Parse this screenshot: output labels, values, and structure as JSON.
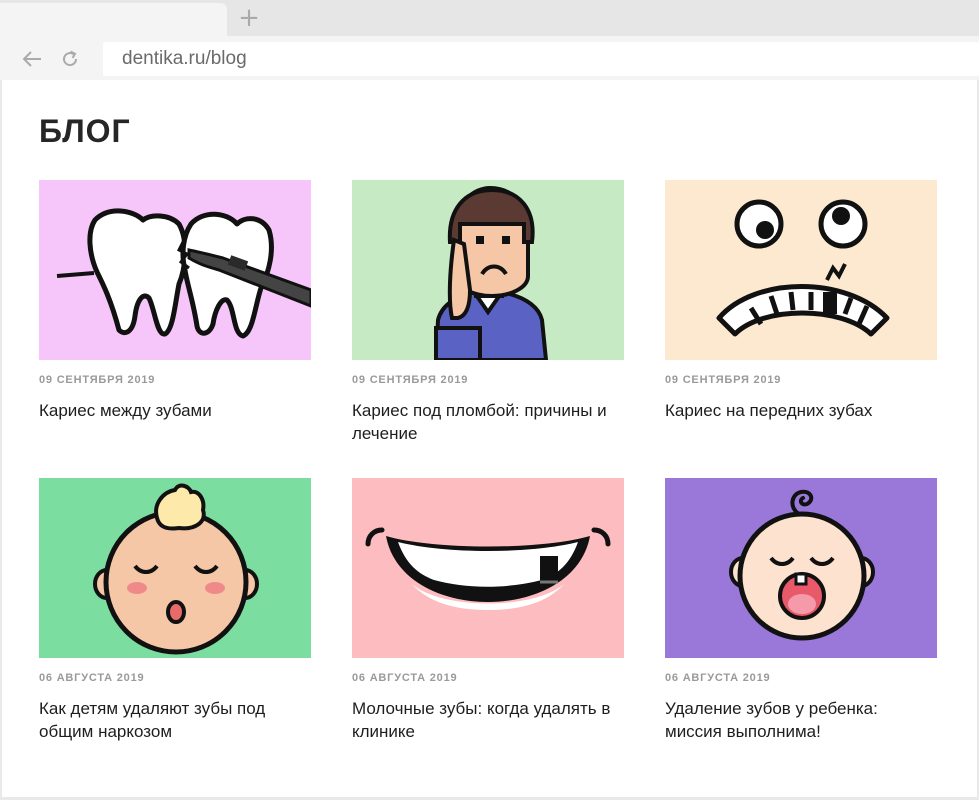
{
  "browser": {
    "url": "dentika.ru/blog",
    "new_tab_symbol": "+",
    "icons": [
      "back-arrow-icon",
      "reload-icon"
    ]
  },
  "page": {
    "heading": "БЛОГ"
  },
  "colors": {
    "card1_bg": "#f6c6fb",
    "card2_bg": "#c6ebc4",
    "card3_bg": "#fde9cf",
    "card4_bg": "#7bdea0",
    "card5_bg": "#fdbcbf",
    "card6_bg": "#9978da"
  },
  "posts": [
    {
      "date": "09 СЕНТЯБРЯ 2019",
      "title": "Кариес между зубами",
      "image": "teeth-probe-illustration"
    },
    {
      "date": "09 СЕНТЯБРЯ 2019",
      "title": "Кариес под пломбой: причины и лечение",
      "image": "man-toothache-illustration"
    },
    {
      "date": "09 СЕНТЯБРЯ 2019",
      "title": "Кариес на передних зубах",
      "image": "scared-face-teeth-illustration"
    },
    {
      "date": "06 АВГУСТА 2019",
      "title": "Как детям удаляют зубы под общим наркозом",
      "image": "sleeping-baby-illustration"
    },
    {
      "date": "06 АВГУСТА 2019",
      "title": "Молочные зубы: когда удалять в клинике",
      "image": "smile-missing-tooth-illustration"
    },
    {
      "date": "06 АВГУСТА 2019",
      "title": "Удаление зубов у ребенка: миссия выполнима!",
      "image": "baby-open-mouth-illustration"
    }
  ]
}
